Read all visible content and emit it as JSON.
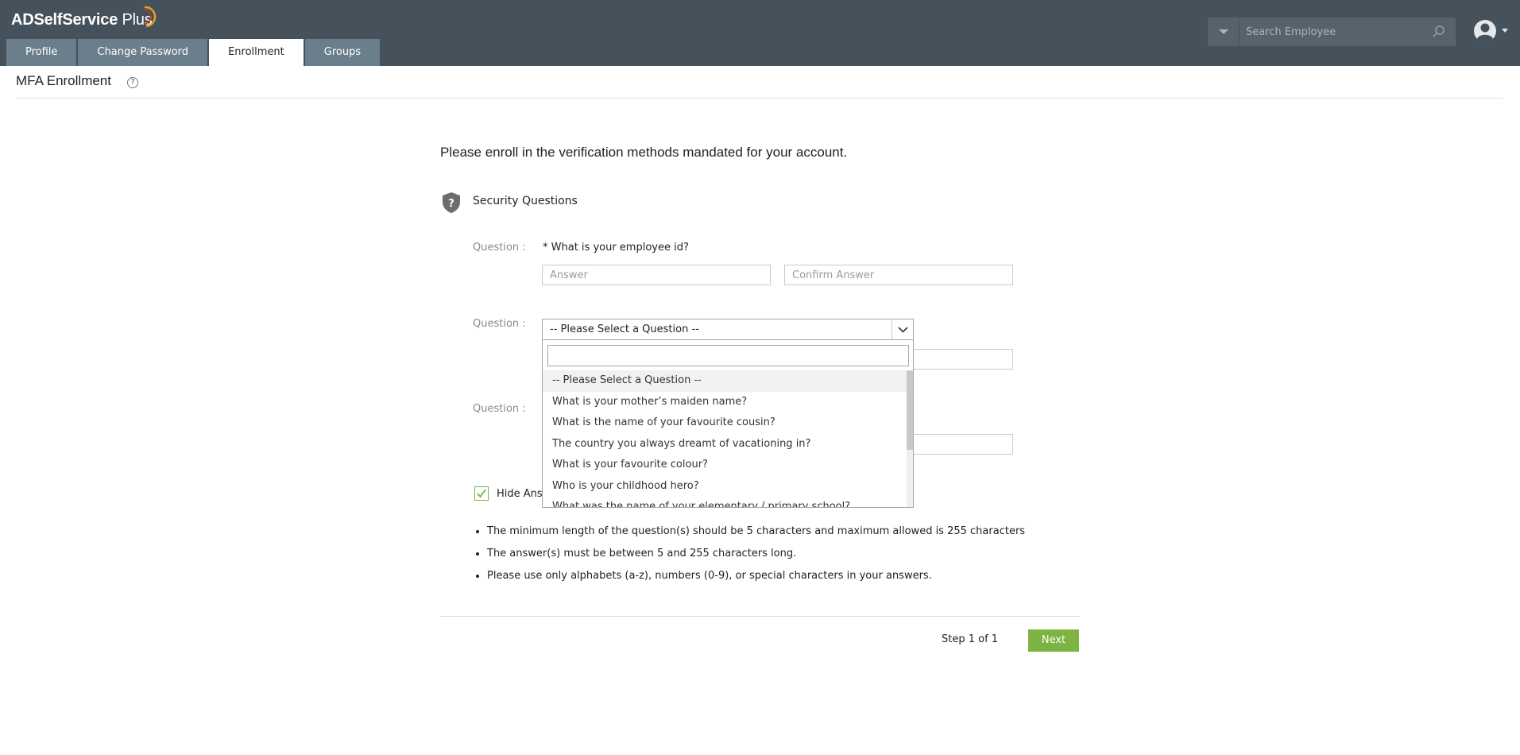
{
  "app": {
    "logo_text": "ADSelfService",
    "logo_plus": "Plus",
    "accent_color": "#7cb342",
    "header_color": "#45525c"
  },
  "tabs": [
    {
      "label": "Profile"
    },
    {
      "label": "Change Password"
    },
    {
      "label": "Enrollment",
      "active": true
    },
    {
      "label": "Groups"
    }
  ],
  "search": {
    "placeholder": "Search Employee"
  },
  "page": {
    "title": "MFA Enrollment",
    "help_icon": "question-circle-icon",
    "intro": "Please enroll in the verification methods mandated for your account.",
    "section_title": "Security Questions",
    "section_icon": "shield-question-icon"
  },
  "questions": {
    "label": "Question :",
    "q1_text": "* What is your employee id?",
    "answer_placeholder": "Answer",
    "confirm_placeholder": "Confirm Answer",
    "select_value": "-- Please Select a Question --"
  },
  "dropdown": {
    "options": [
      "-- Please Select a Question --",
      "What is your mother’s maiden name?",
      "What is the name of your favourite cousin?",
      "The country you always dreamt of vacationing in?",
      "What is your favourite colour?",
      "Who is your childhood hero?",
      "What was the name of your elementary / primary school?"
    ]
  },
  "hide_answers": {
    "label": "Hide Ans",
    "checked": true
  },
  "notes": [
    "The minimum length of the question(s) should be 5 characters and maximum allowed is 255 characters",
    "The answer(s) must be between 5 and 255 characters long.",
    "Please use only alphabets (a-z), numbers (0-9), or special characters in your answers."
  ],
  "footer": {
    "step": "Step 1 of 1",
    "next_label": "Next"
  }
}
